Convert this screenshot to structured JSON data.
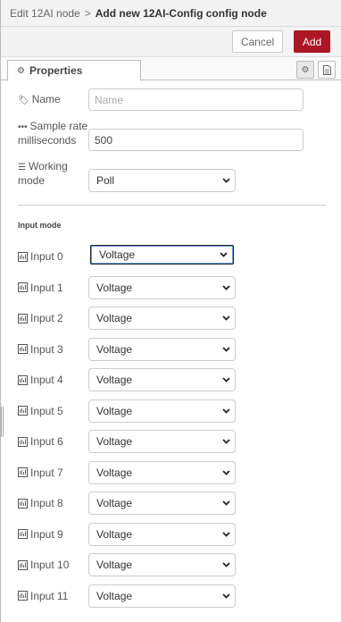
{
  "header": {
    "breadcrumb_prev": "Edit 12AI node",
    "separator": ">",
    "breadcrumb_current": "Add new 12AI-Config config node"
  },
  "toolbar": {
    "cancel_label": "Cancel",
    "add_label": "Add",
    "add_color": "#ad1625"
  },
  "tabs": {
    "properties_label": "Properties",
    "properties_icon": "gear-icon",
    "side_buttons": [
      "gear-icon",
      "document-icon"
    ]
  },
  "form": {
    "name": {
      "label": "Name",
      "icon": "tag-icon",
      "value": "",
      "placeholder": "Name"
    },
    "sample_rate": {
      "label_line1": "Sample rate",
      "label_line2": "milliseconds",
      "icon": "ellipsis-icon",
      "value": "500"
    },
    "working_mode": {
      "label_line1": "Working",
      "label_line2": "mode",
      "icon": "list-icon",
      "value": "Poll"
    }
  },
  "input_mode": {
    "title": "Input mode",
    "inputs": [
      {
        "label": "Input 0",
        "value": "Voltage"
      },
      {
        "label": "Input 1",
        "value": "Voltage"
      },
      {
        "label": "Input 2",
        "value": "Voltage"
      },
      {
        "label": "Input 3",
        "value": "Voltage"
      },
      {
        "label": "Input 4",
        "value": "Voltage"
      },
      {
        "label": "Input 5",
        "value": "Voltage"
      },
      {
        "label": "Input 6",
        "value": "Voltage"
      },
      {
        "label": "Input 7",
        "value": "Voltage"
      },
      {
        "label": "Input 8",
        "value": "Voltage"
      },
      {
        "label": "Input 9",
        "value": "Voltage"
      },
      {
        "label": "Input 10",
        "value": "Voltage"
      },
      {
        "label": "Input 11",
        "value": "Voltage"
      }
    ]
  }
}
